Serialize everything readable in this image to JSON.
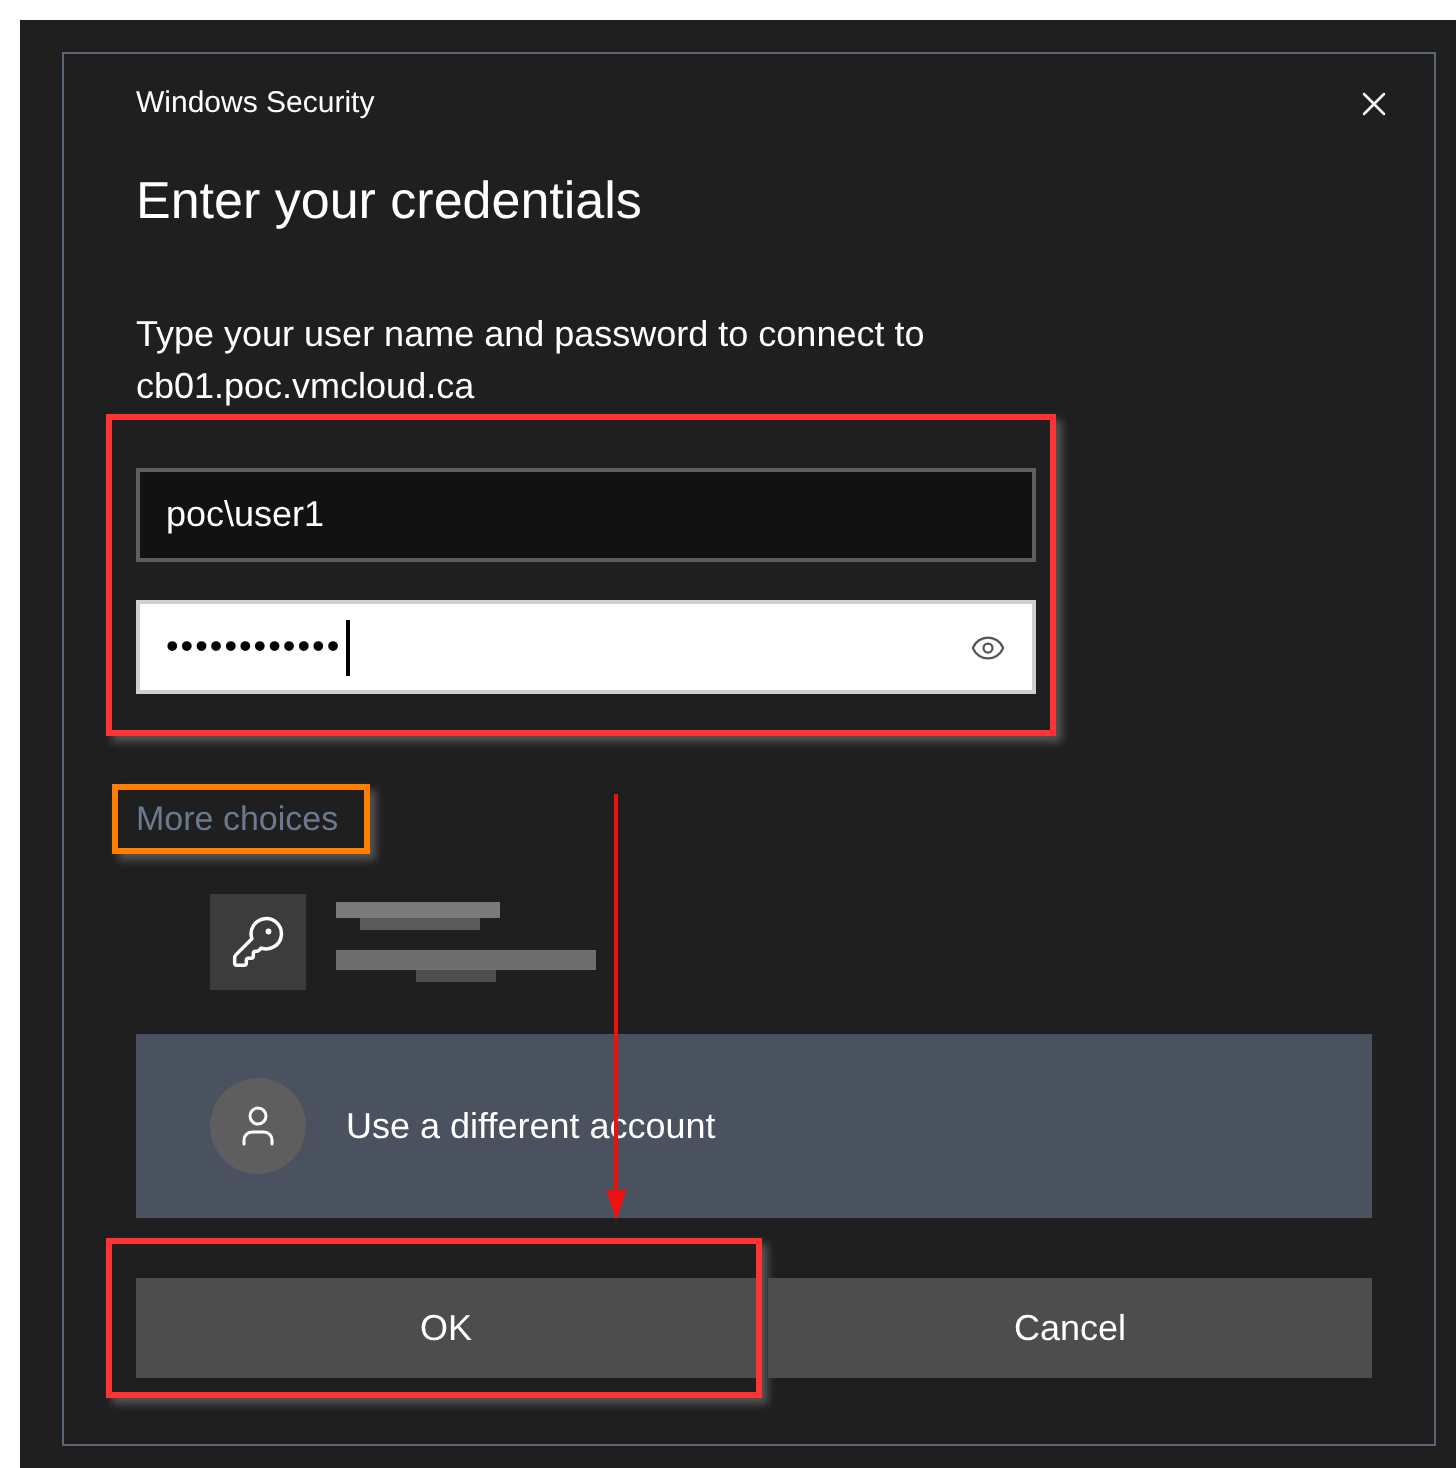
{
  "window": {
    "title": "Windows Security"
  },
  "heading": "Enter your credentials",
  "message_lines": [
    "Type your user name and password to connect to",
    "cb01.poc.vmcloud.ca"
  ],
  "credentials": {
    "highlight": {
      "color": "#ff3333"
    },
    "fields": [
      {
        "kind": "text",
        "value": "poc\\user1",
        "focused": false
      },
      {
        "kind": "password",
        "value": "••••••••••••",
        "focused": true
      }
    ]
  },
  "more_choices": {
    "label": "More choices",
    "highlight": {
      "color": "#ff8000"
    }
  },
  "other_account": {
    "label": "Use a different account",
    "selected": true
  },
  "buttons": [
    {
      "label": "OK",
      "highlight": {
        "color": "#ff3333"
      }
    },
    {
      "label": "Cancel"
    }
  ],
  "arrow": {
    "color": "#ee1111"
  }
}
